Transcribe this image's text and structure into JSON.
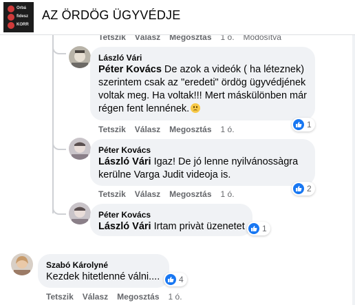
{
  "header": {
    "page_name": "AZ ÖRDÖG ÜGYVÉDJE",
    "thumb_lines": [
      "Orbá",
      "fidesz",
      "KORR"
    ]
  },
  "prev_actions": {
    "like": "Tetszik",
    "reply": "Válasz",
    "share": "Megosztás",
    "time": "1 ó.",
    "edited": "Módosítva"
  },
  "comments": [
    {
      "author": "László Vári",
      "mention": "Péter Kovács",
      "text": " De azok a videók ( ha léteznek) szerintem csak az \"eredeti\" ördög ügyvédjének voltak meg. Ha voltak!!! Mert máskülönben már régen fent lennének.",
      "reaction_count": "1",
      "actions": {
        "like": "Tetszik",
        "reply": "Válasz",
        "share": "Megosztás",
        "time": "1 ó."
      }
    },
    {
      "author": "Péter Kovács",
      "mention": "László Vári",
      "text": " Igaz! De jó lenne nyilvánossàgra kerülne Varga Judit videoja is.",
      "reaction_count": "2",
      "actions": {
        "like": "Tetszik",
        "reply": "Válasz",
        "share": "Megosztás",
        "time": "1 ó."
      }
    },
    {
      "author": "Péter Kovács",
      "mention": "László Vári",
      "text": " Irtam privàt üzenetet",
      "reaction_count": "1"
    },
    {
      "author": "Szabó Károlyné",
      "text": "Kezdek hitetlenné válni....",
      "reaction_count": "4",
      "actions": {
        "like": "Tetszik",
        "reply": "Válasz",
        "share": "Megosztás",
        "time": "1 ó."
      }
    }
  ],
  "colors": {
    "like_blue": "#1877f2",
    "bubble": "#f0f2f5",
    "meta_gray": "#65676b"
  }
}
